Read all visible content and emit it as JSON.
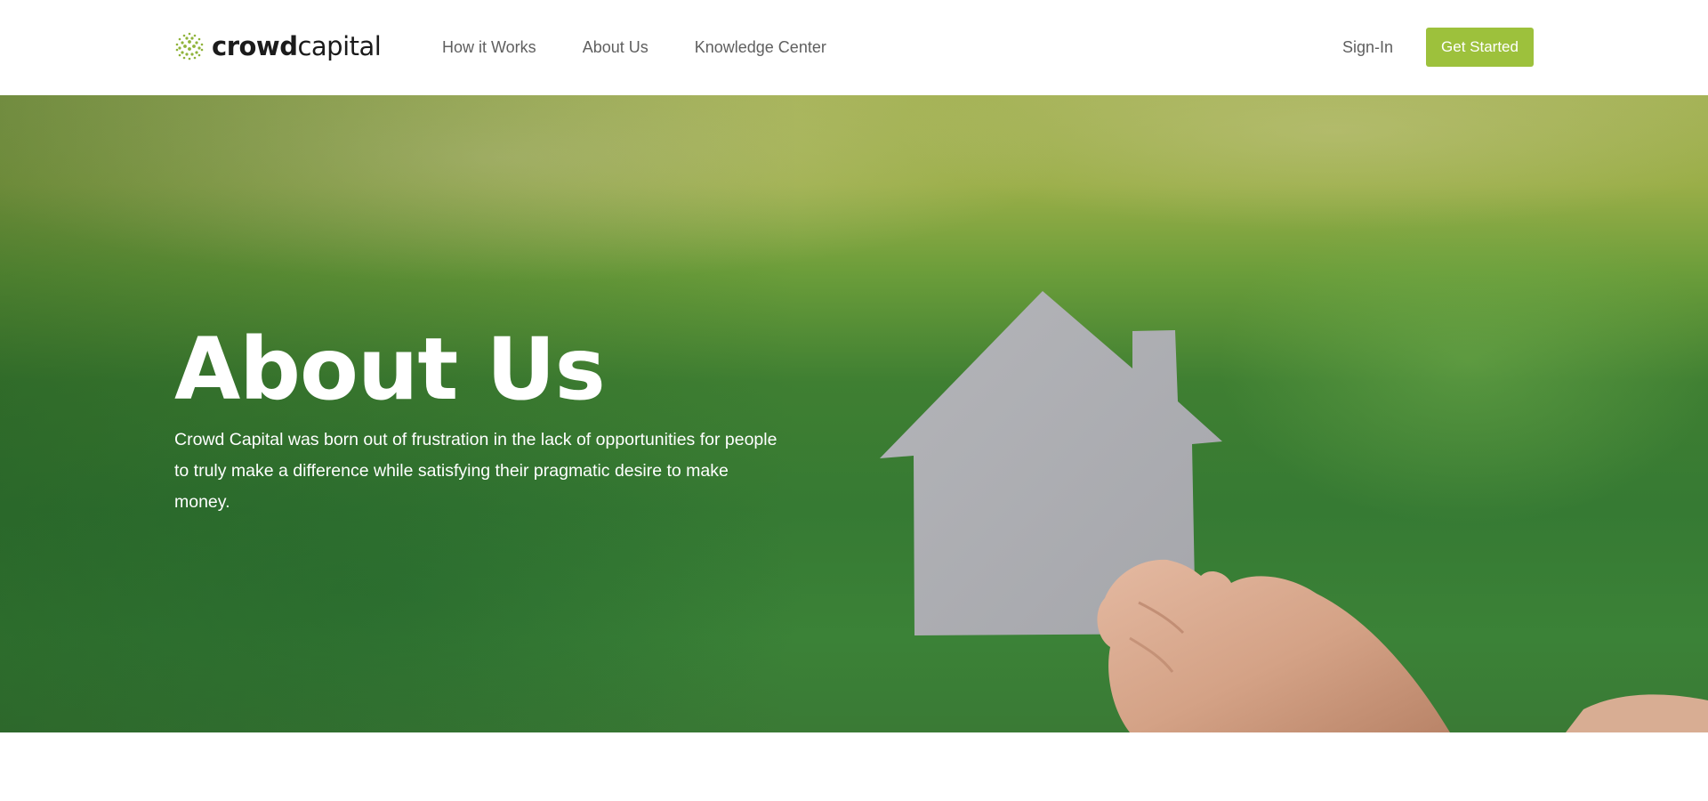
{
  "header": {
    "logo": {
      "bold": "crowd",
      "light": "capital",
      "icon": "dotted-globe-icon"
    },
    "nav": [
      {
        "label": "How it Works"
      },
      {
        "label": "About Us"
      },
      {
        "label": "Knowledge Center"
      }
    ],
    "sign_in_label": "Sign-In",
    "cta_label": "Get Started"
  },
  "hero": {
    "title": "About Us",
    "description": "Crowd Capital was born out of frustration in the lack of opportunities for people to truly make a difference while satisfying their pragmatic desire to make money.",
    "image": "paper-house-in-hand"
  },
  "colors": {
    "accent": "#9dc13c",
    "nav_text": "#5f5f5f",
    "logo_text": "#1b1b1b",
    "hero_text": "#ffffff"
  }
}
